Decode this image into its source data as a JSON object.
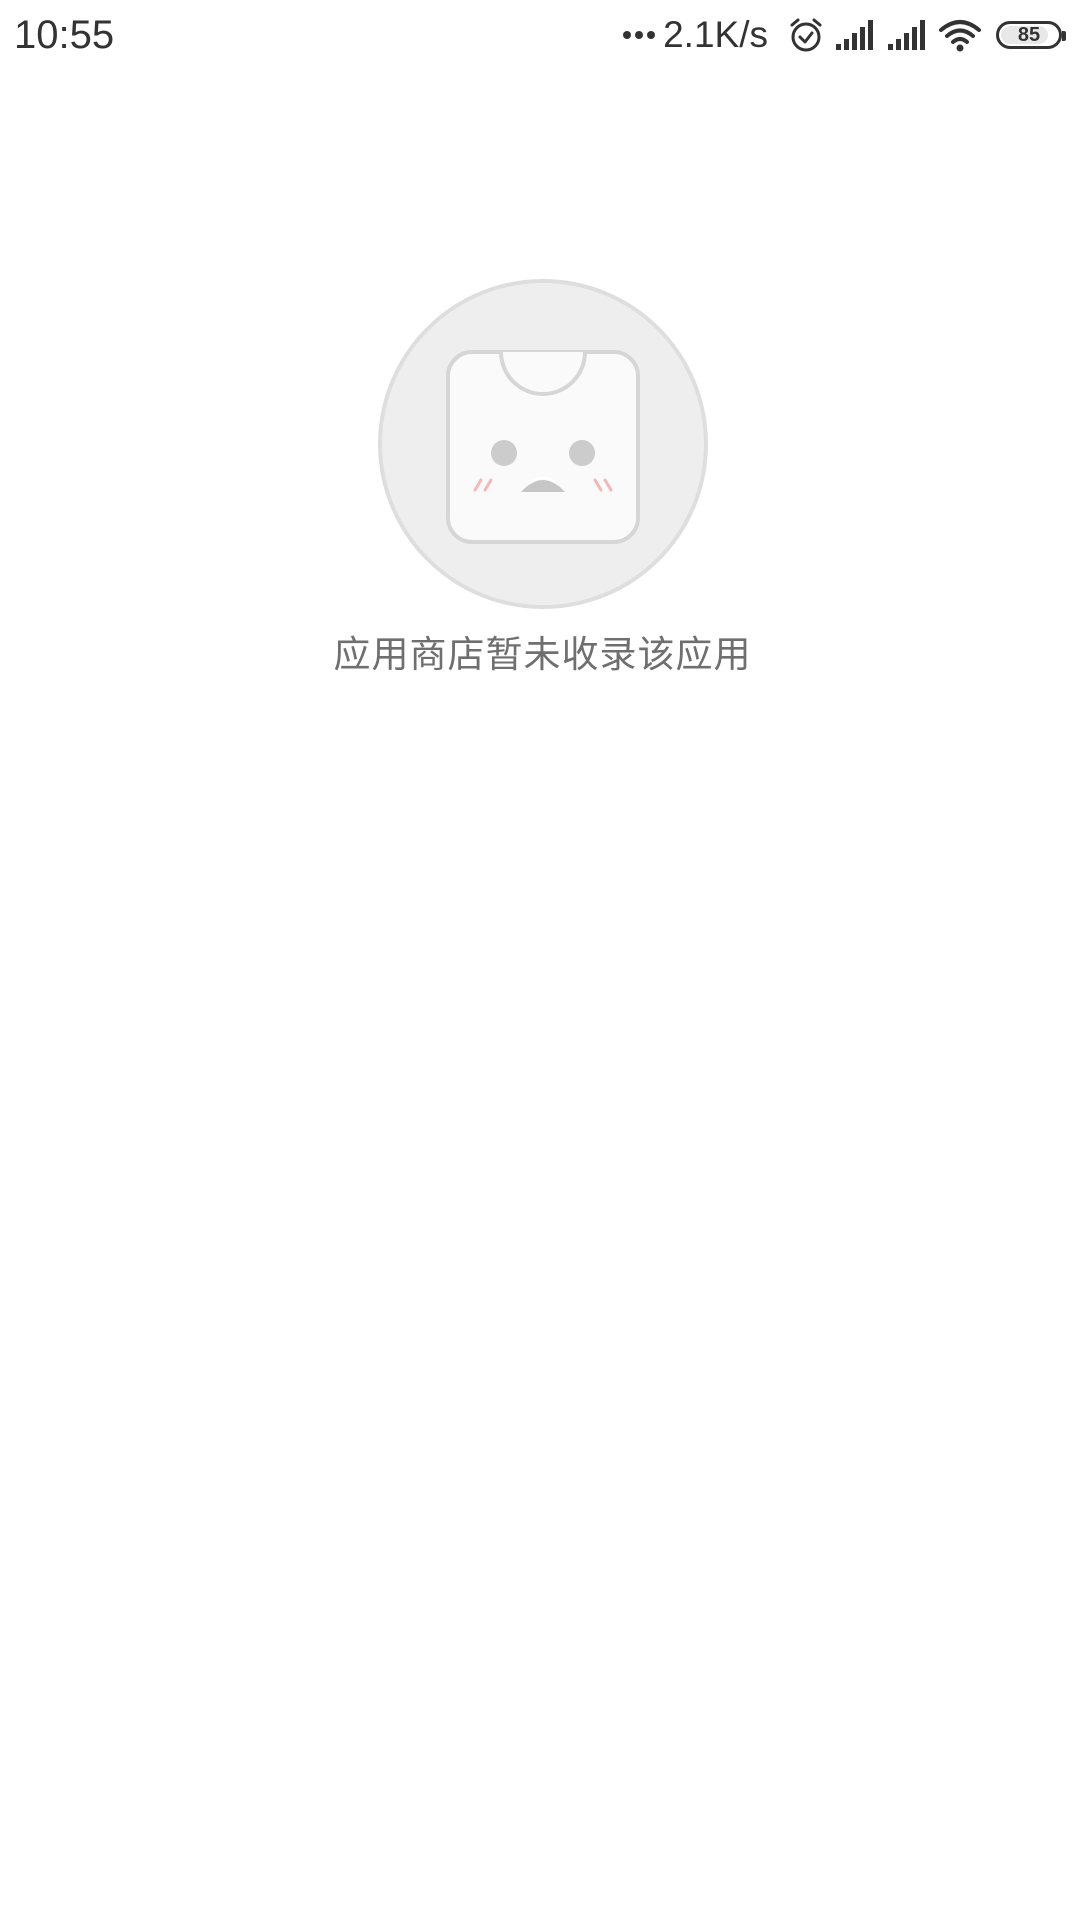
{
  "status_bar": {
    "time": "10:55",
    "net_speed": "2.1K/s",
    "battery_level": "85",
    "battery_percent": 85,
    "icons": [
      "more-dots-icon",
      "alarm-icon",
      "signal-icon",
      "signal-icon",
      "wifi-icon",
      "battery-icon"
    ]
  },
  "empty_state": {
    "illustration": "sad-app-store-bag-icon",
    "message": "应用商店暂未收录该应用"
  },
  "colors": {
    "background": "#ffffff",
    "text_primary": "#333333",
    "text_secondary": "#6f6f6f",
    "illustration_circle": "#eeeeee",
    "illustration_stroke": "#d9d9d9",
    "blush": "#f2b8b8"
  }
}
